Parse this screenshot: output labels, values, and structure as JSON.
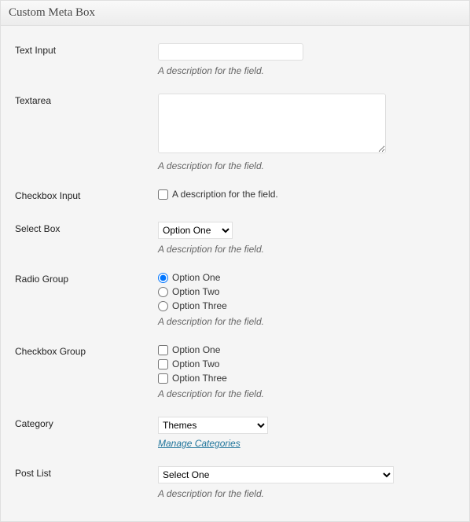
{
  "metabox": {
    "title": "Custom Meta Box"
  },
  "fields": {
    "text_input": {
      "label": "Text Input",
      "value": "",
      "desc": "A description for the field."
    },
    "textarea": {
      "label": "Textarea",
      "value": "",
      "desc": "A description for the field."
    },
    "checkbox_input": {
      "label": "Checkbox Input",
      "option_label": "A description for the field."
    },
    "select_box": {
      "label": "Select Box",
      "selected": "Option One",
      "desc": "A description for the field."
    },
    "radio_group": {
      "label": "Radio Group",
      "options": [
        "Option One",
        "Option Two",
        "Option Three"
      ],
      "desc": "A description for the field."
    },
    "checkbox_group": {
      "label": "Checkbox Group",
      "options": [
        "Option One",
        "Option Two",
        "Option Three"
      ],
      "desc": "A description for the field."
    },
    "category": {
      "label": "Category",
      "selected": "Themes",
      "manage_link": "Manage Categories"
    },
    "post_list": {
      "label": "Post List",
      "selected": "Select One",
      "desc": "A description for the field."
    }
  }
}
